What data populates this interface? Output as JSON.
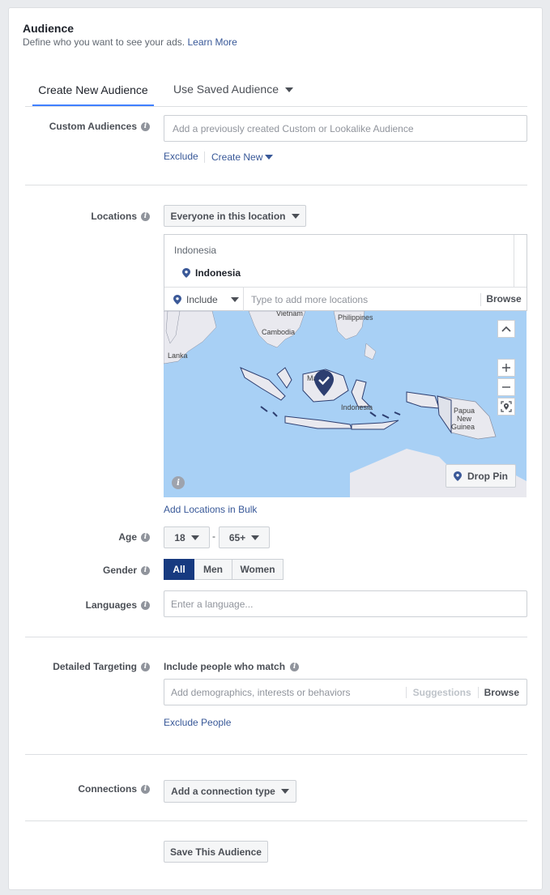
{
  "header": {
    "title": "Audience",
    "subtitle": "Define who you want to see your ads.",
    "learn_more": "Learn More"
  },
  "tabs": {
    "create_new": "Create New Audience",
    "use_saved": "Use Saved Audience"
  },
  "custom_audiences": {
    "label": "Custom Audiences",
    "placeholder": "Add a previously created Custom or Lookalike Audience",
    "exclude": "Exclude",
    "create_new": "Create New"
  },
  "locations": {
    "label": "Locations",
    "dropdown": "Everyone in this location",
    "group_header": "Indonesia",
    "selected": "Indonesia",
    "include": "Include",
    "placeholder": "Type to add more locations",
    "browse": "Browse",
    "add_bulk": "Add Locations in Bulk",
    "drop_pin": "Drop Pin",
    "map_labels": {
      "vietnam": "Vietnam",
      "philippines": "Philippines",
      "cambodia": "Cambodia",
      "lanka": "Lanka",
      "malaysia": "Ma",
      "indonesia": "Indonesia",
      "papua1": "Papua",
      "papua2": "New",
      "papua3": "Guinea"
    }
  },
  "age": {
    "label": "Age",
    "min": "18",
    "max": "65+",
    "sep": "-"
  },
  "gender": {
    "label": "Gender",
    "options": [
      "All",
      "Men",
      "Women"
    ],
    "selected": "All"
  },
  "languages": {
    "label": "Languages",
    "placeholder": "Enter a language..."
  },
  "detailed_targeting": {
    "label": "Detailed Targeting",
    "include_text": "Include people who match",
    "placeholder": "Add demographics, interests or behaviors",
    "suggestions": "Suggestions",
    "browse": "Browse",
    "exclude": "Exclude People"
  },
  "connections": {
    "label": "Connections",
    "dropdown": "Add a connection type"
  },
  "save_button": "Save This Audience",
  "colors": {
    "accent": "#4080ff",
    "link": "#385898",
    "selected_gender": "#173a80",
    "map_water": "#a8d0f5"
  }
}
